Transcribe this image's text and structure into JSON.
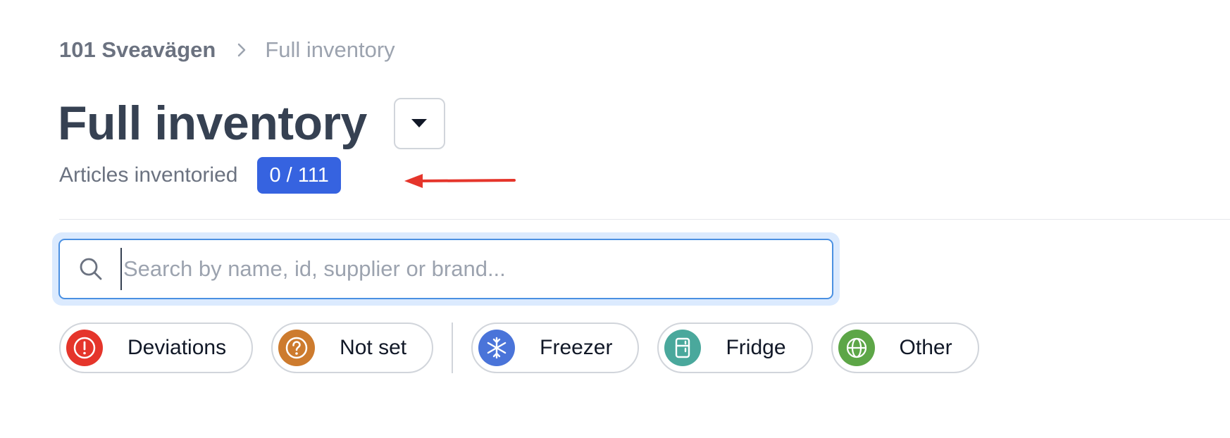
{
  "breadcrumb": {
    "root": "101 Sveavägen",
    "current": "Full inventory"
  },
  "header": {
    "title": "Full inventory",
    "subtitle_label": "Articles inventoried",
    "count_badge": "0 / 111"
  },
  "search": {
    "placeholder": "Search by name, id, supplier or brand...",
    "value": ""
  },
  "filters": [
    {
      "label": "Deviations",
      "icon": "exclamation-circle-icon",
      "color": "#e5352b"
    },
    {
      "label": "Not set",
      "icon": "question-circle-icon",
      "color": "#cd7b2e"
    },
    {
      "label": "Freezer",
      "icon": "snowflake-icon",
      "color": "#4a74d9"
    },
    {
      "label": "Fridge",
      "icon": "fridge-icon",
      "color": "#4aa89c"
    },
    {
      "label": "Other",
      "icon": "globe-icon",
      "color": "#5da647"
    }
  ],
  "colors": {
    "accent": "#3663e0",
    "annotation_arrow": "#e5352b"
  }
}
